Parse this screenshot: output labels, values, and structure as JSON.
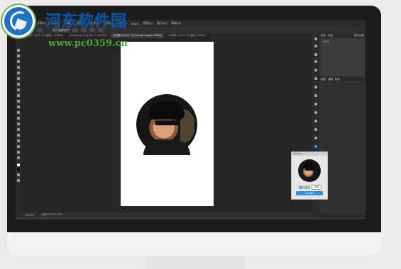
{
  "watermark": {
    "title": "河东软件园",
    "url": "www.pc0359.cn"
  },
  "photoshop": {
    "menu": [
      "文件(F)",
      "编辑(E)",
      "图像(I)",
      "图层(L)",
      "文字(Y)",
      "选择(S)",
      "滤镜(T)",
      "3D(D)",
      "视图(V)",
      "窗口(W)",
      "帮助(H)"
    ],
    "options_label": "显示变换控件",
    "tabs": [
      {
        "label": "未标题-1 @ 66.7% (图层 1, RGB/8)",
        "active": false
      },
      {
        "label": "Circular pic_05 @ 66.7% (RGB/8)",
        "active": false
      },
      {
        "label": "未标题-2 @ 66.7% (Circular sample, RGB/8)",
        "active": true
      },
      {
        "label": "未标题-3 @ 66.7% (图层, RGB/8)",
        "active": false
      }
    ],
    "status": {
      "zoom": "66.67%",
      "doc": "文档:844.8K/1.42M"
    },
    "panels": {
      "top_tabs": [
        "颜色",
        "色板"
      ],
      "top_right": "基本功能",
      "top_body": "无属性",
      "layers_tabs": [
        "图层",
        "通道",
        "路径"
      ]
    }
  },
  "dialog": {
    "title": "Circular",
    "field_label": "圆形直径",
    "field_value": "300",
    "button_label": "Circular!"
  }
}
